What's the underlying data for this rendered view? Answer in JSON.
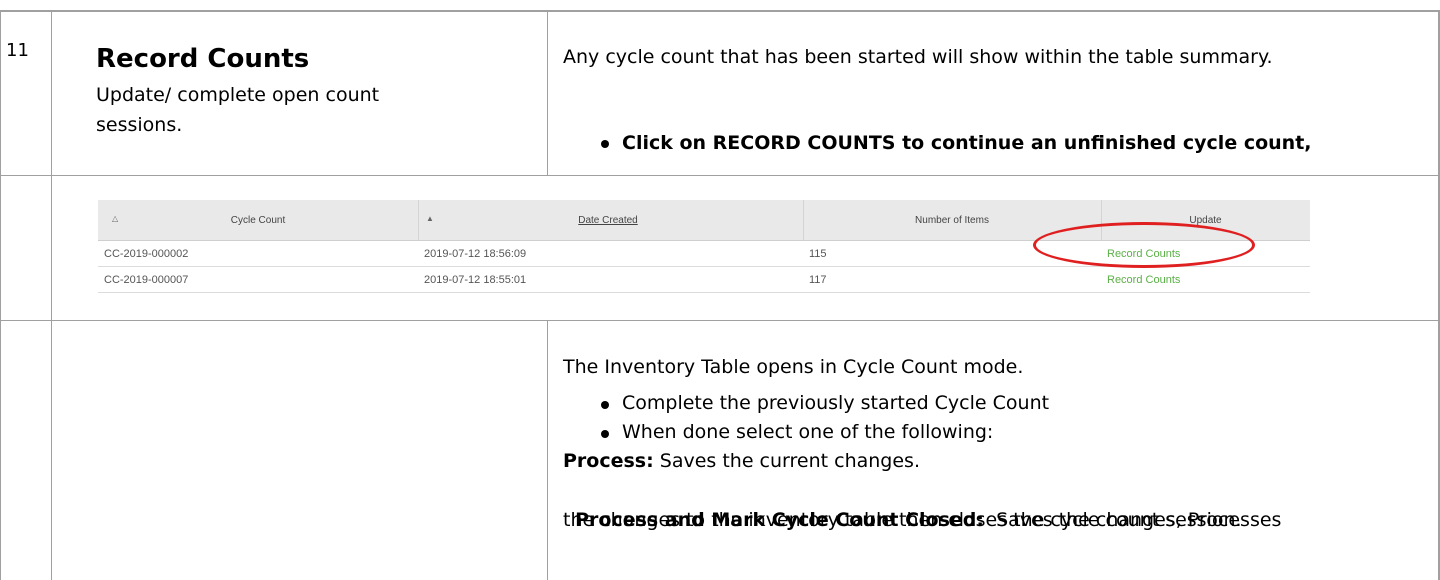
{
  "step_number": "11",
  "section": {
    "title": "Record Counts",
    "subtitle": "Update/ complete open count sessions."
  },
  "intro": {
    "text": "Any cycle count that has been started will show within the table summary.",
    "bullet": "Click on RECORD COUNTS to continue an unfinished cycle count,"
  },
  "embedded_table": {
    "headers": [
      "Cycle Count",
      "Date Created",
      "Number of Items",
      "Update"
    ],
    "rows": [
      {
        "cycle_count": "CC-2019-000002",
        "date_created": "2019-07-12 18:56:09",
        "items": "115",
        "action": "Record Counts"
      },
      {
        "cycle_count": "CC-2019-000007",
        "date_created": "2019-07-12 18:55:01",
        "items": "117",
        "action": "Record Counts"
      }
    ],
    "accent_color": "#5ab046",
    "highlight_color": "#e02020"
  },
  "details": {
    "line1": "The Inventory Table opens in Cycle Count mode.",
    "bullets": [
      "Complete the previously started Cycle Count",
      "When done select one of the following:"
    ],
    "process_label": "Process:",
    "process_text": " Saves the current changes.",
    "close_label": "Process and Mark Cycle Count Closed:",
    "close_text": "  Saves the changes, Processes",
    "close_text2": "the changes to the inventory table then closes the cycle count session."
  }
}
